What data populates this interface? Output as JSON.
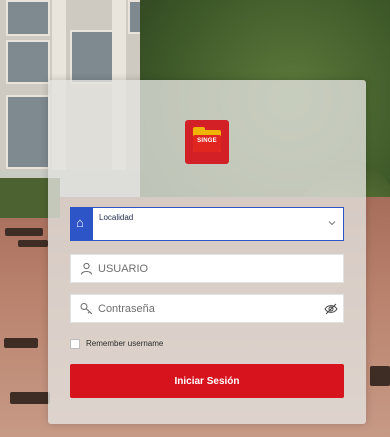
{
  "logo": {
    "brand_text": "SINGE"
  },
  "locality": {
    "label": "Localidad",
    "lead_icon": "building-icon",
    "chevron_icon": "chevron-down-icon"
  },
  "username": {
    "placeholder": "USUARIO",
    "icon": "user-icon"
  },
  "password": {
    "placeholder": "Contraseña",
    "icon": "key-icon",
    "toggle_icon": "eye-off-icon"
  },
  "remember": {
    "label": "Remember username",
    "checked": false
  },
  "submit": {
    "label": "Iniciar Sesión"
  },
  "colors": {
    "primary_red": "#d7141d",
    "accent_blue": "#2d55c7",
    "logo_yellow": "#f0b400"
  }
}
